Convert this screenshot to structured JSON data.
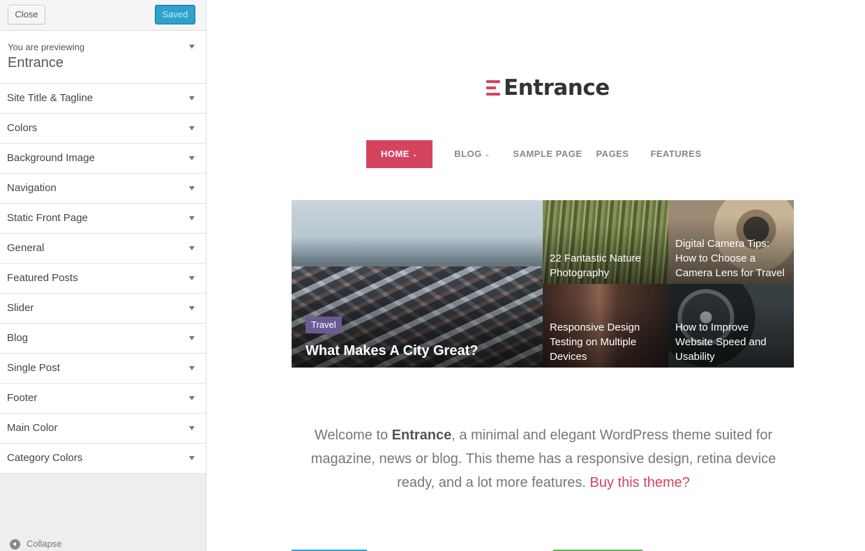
{
  "sidebar": {
    "close_label": "Close",
    "saved_label": "Saved",
    "preview_small": "You are previewing",
    "preview_theme": "Entrance",
    "sections": [
      "Site Title & Tagline",
      "Colors",
      "Background Image",
      "Navigation",
      "Static Front Page",
      "General",
      "Featured Posts",
      "Slider",
      "Blog",
      "Single Post",
      "Footer",
      "Main Color",
      "Category Colors"
    ],
    "collapse_label": "Collapse"
  },
  "site": {
    "logo_text": "Entrance",
    "accent_color": "#d6435f",
    "nav": [
      {
        "label": "HOME",
        "has_dropdown": true,
        "active": true
      },
      {
        "label": "BLOG",
        "has_dropdown": true,
        "active": false
      },
      {
        "label": "SAMPLE PAGE",
        "has_dropdown": false,
        "active": false
      },
      {
        "label": "PAGES",
        "has_dropdown": false,
        "active": false
      },
      {
        "label": "FEATURES",
        "has_dropdown": false,
        "active": false
      }
    ],
    "featured": {
      "main": {
        "category": "Travel",
        "title": "What Makes A City Great?"
      },
      "tiles": [
        {
          "title": "22 Fantastic Nature Photography"
        },
        {
          "title": "Digital Camera Tips: How to Choose a Camera Lens for Travel"
        },
        {
          "title": "Responsive Design Testing on Multiple Devices"
        },
        {
          "title": "How to Improve Website Speed and Usability"
        }
      ]
    },
    "welcome": {
      "prefix": "Welcome to ",
      "bold": "Entrance",
      "rest": ", a minimal and elegant WordPress theme suited for magazine, news or blog. This theme has a responsive design, retina device ready, and a lot more features. ",
      "link": "Buy this theme?"
    }
  }
}
